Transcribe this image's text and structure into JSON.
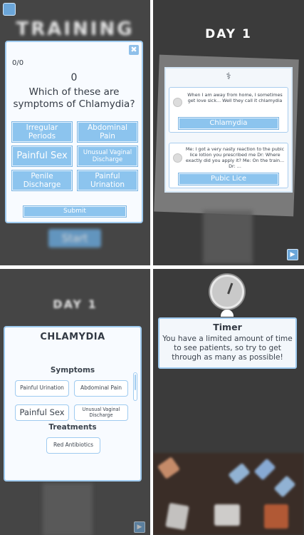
{
  "panel1": {
    "title": "TRAINING",
    "start_label": "Start",
    "quiz": {
      "close_glyph": "✖",
      "progress": "0/0",
      "score": "0",
      "question": "Which of these are symptoms of Chlamydia?",
      "options": [
        "Irregular Periods",
        "Abdominal Pain",
        "Painful Sex",
        "Unusual Vaginal Discharge",
        "Penile Discharge",
        "Painful Urination"
      ],
      "submit_label": "Submit"
    }
  },
  "panel2": {
    "day_title": "DAY 1",
    "patients": [
      {
        "quote": "When I am away from home, I sometimes get love sick... Well they call it chlamydia",
        "diagnosis": "Chlamydia"
      },
      {
        "quote": "Me: I got a very nasty reaction to the pubic lice lotion you prescribed me Dr: Where exactly did you apply it? Me: On the train... Dr: ...",
        "diagnosis": "Pubic Lice"
      }
    ],
    "next_glyph": "▶"
  },
  "panel3": {
    "day_title": "DAY 1",
    "info": {
      "title": "CHLAMYDIA",
      "symptoms_heading": "Symptoms",
      "symptoms": [
        "Painful Urination",
        "Abdominal Pain",
        "Painful Sex",
        "Unusual Vaginal Discharge"
      ],
      "treatments_heading": "Treatments",
      "treatments": [
        "Red Antibiotics"
      ]
    },
    "next_glyph": "▶"
  },
  "panel4": {
    "timer_title": "Timer",
    "timer_text": "You have a limited amount of time to see patients, so try to get through as many as possible!"
  },
  "colors": {
    "accent": "#8cc4ee",
    "accent_border": "#9fcbf0",
    "text_dark": "#333a44",
    "background_dark": "#454545",
    "desk": "#3a2d27"
  }
}
